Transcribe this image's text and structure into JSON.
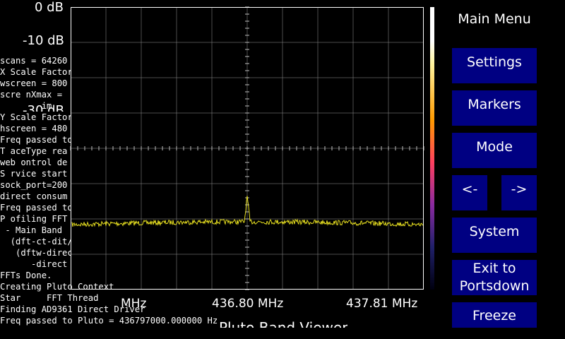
{
  "y_labels": [
    "0 dB",
    "-10 dB",
    "-30 dB"
  ],
  "x_labels": {
    "left": "MHz",
    "center": "436.80 MHz",
    "right": "437.81 MHz"
  },
  "console_lines": [
    "scans = 64260",
    "X Scale Factor",
    "wscreen = 800",
    "scre nXmax = ",
    "        im",
    "Y Scale Factor",
    "hscreen = 480",
    "Freq passed to",
    "T aceType rea",
    "web ontrol de",
    "S rvice start",
    "sock_port=200",
    "direct consum",
    "Freq passed to",
    "P ofiling FFT",
    " - Main Band ",
    "  (dft-ct-dit/",
    "   (dftw-direc",
    "      -direct",
    "FFTs Done.",
    "Creating Pluto Context",
    "Star     FFT Thread",
    "Finding AD9361 Direct Driver",
    "Freq passed to Pluto = 436797000.000000 Hz"
  ],
  "footer_title": "Pluto Band Viewer",
  "menu": {
    "title": "Main Menu",
    "settings": "Settings",
    "markers": "Markers",
    "mode": "Mode",
    "left": "<-",
    "right": "->",
    "system": "System",
    "exit_line1": "Exit to",
    "exit_line2": "Portsdown",
    "freeze": "Freeze"
  },
  "colors": {
    "trace": "#e8e020",
    "graticule": "#808080",
    "button_bg": "#000082"
  }
}
